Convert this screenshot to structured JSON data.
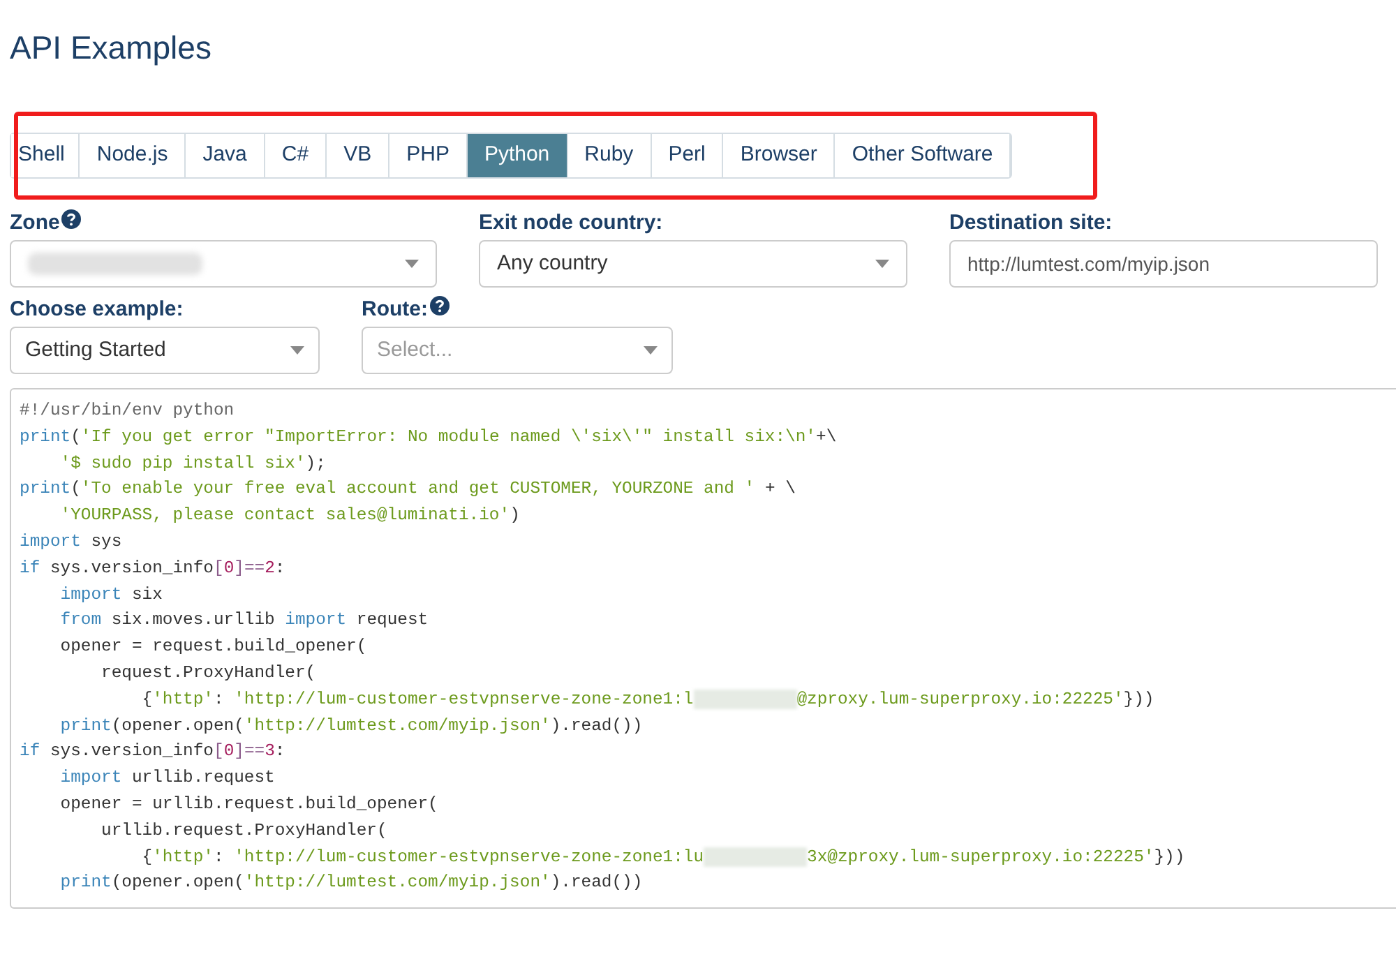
{
  "title": "API Examples",
  "tabs": [
    {
      "label": "Shell",
      "selected": false
    },
    {
      "label": "Node.js",
      "selected": false
    },
    {
      "label": "Java",
      "selected": false
    },
    {
      "label": "C#",
      "selected": false
    },
    {
      "label": "VB",
      "selected": false
    },
    {
      "label": "PHP",
      "selected": false
    },
    {
      "label": "Python",
      "selected": true
    },
    {
      "label": "Ruby",
      "selected": false
    },
    {
      "label": "Perl",
      "selected": false
    },
    {
      "label": "Browser",
      "selected": false
    },
    {
      "label": "Other Software",
      "selected": false
    }
  ],
  "zone": {
    "label": "Zone",
    "help": true,
    "redacted": true
  },
  "exit_node_country": {
    "label": "Exit node country:",
    "value": "Any country"
  },
  "destination_site": {
    "label": "Destination site:",
    "value": "http://lumtest.com/myip.json"
  },
  "choose_example": {
    "label": "Choose example:",
    "value": "Getting Started"
  },
  "route": {
    "label": "Route:",
    "help": true,
    "placeholder": "Select..."
  },
  "code": [
    [
      {
        "kind": "comment",
        "text": "#!/usr/bin/env python"
      }
    ],
    [
      {
        "kind": "kw",
        "text": "print"
      },
      {
        "kind": "plain",
        "text": "("
      },
      {
        "kind": "str",
        "text": "'If you get error \"ImportError: No module named \\'six\\'\" install six:\\n'"
      },
      {
        "kind": "plain",
        "text": "+\\"
      }
    ],
    [
      {
        "kind": "str",
        "text": "    '$ sudo pip install six'"
      },
      {
        "kind": "plain",
        "text": ");"
      }
    ],
    [
      {
        "kind": "kw",
        "text": "print"
      },
      {
        "kind": "plain",
        "text": "("
      },
      {
        "kind": "str",
        "text": "'To enable your free eval account and get CUSTOMER, YOURZONE and '"
      },
      {
        "kind": "plain",
        "text": " + \\"
      }
    ],
    [
      {
        "kind": "str",
        "text": "    'YOURPASS, please contact sales@luminati.io'"
      },
      {
        "kind": "plain",
        "text": ")"
      }
    ],
    [
      {
        "kind": "kw",
        "text": "import"
      },
      {
        "kind": "plain",
        "text": " sys"
      }
    ],
    [
      {
        "kind": "kw",
        "text": "if"
      },
      {
        "kind": "plain",
        "text": " sys.version_info"
      },
      {
        "kind": "op",
        "text": "["
      },
      {
        "kind": "num",
        "text": "0"
      },
      {
        "kind": "op",
        "text": "]=="
      },
      {
        "kind": "num",
        "text": "2"
      },
      {
        "kind": "plain",
        "text": ":"
      }
    ],
    [
      {
        "kind": "kw",
        "text": "    import"
      },
      {
        "kind": "plain",
        "text": " six"
      }
    ],
    [
      {
        "kind": "kw",
        "text": "    from"
      },
      {
        "kind": "plain",
        "text": " six.moves.urllib "
      },
      {
        "kind": "kw",
        "text": "import"
      },
      {
        "kind": "plain",
        "text": " request"
      }
    ],
    [
      {
        "kind": "plain",
        "text": "    opener = request.build_opener("
      }
    ],
    [
      {
        "kind": "plain",
        "text": "        request.ProxyHandler("
      }
    ],
    [
      {
        "kind": "plain",
        "text": "            {"
      },
      {
        "kind": "str",
        "text": "'http'"
      },
      {
        "kind": "plain",
        "text": ": "
      },
      {
        "kind": "str",
        "text": "'http://lum-customer-estvpnserve-zone-zone1:l"
      },
      {
        "kind": "redacted"
      },
      {
        "kind": "str",
        "text": "@zproxy.lum-superproxy.io:22225'"
      },
      {
        "kind": "plain",
        "text": "}))"
      }
    ],
    [
      {
        "kind": "kw",
        "text": "    print"
      },
      {
        "kind": "plain",
        "text": "(opener.open("
      },
      {
        "kind": "str",
        "text": "'http://lumtest.com/myip.json'"
      },
      {
        "kind": "plain",
        "text": ").read())"
      }
    ],
    [
      {
        "kind": "kw",
        "text": "if"
      },
      {
        "kind": "plain",
        "text": " sys.version_info"
      },
      {
        "kind": "op",
        "text": "["
      },
      {
        "kind": "num",
        "text": "0"
      },
      {
        "kind": "op",
        "text": "]=="
      },
      {
        "kind": "num",
        "text": "3"
      },
      {
        "kind": "plain",
        "text": ":"
      }
    ],
    [
      {
        "kind": "kw",
        "text": "    import"
      },
      {
        "kind": "plain",
        "text": " urllib.request"
      }
    ],
    [
      {
        "kind": "plain",
        "text": "    opener = urllib.request.build_opener("
      }
    ],
    [
      {
        "kind": "plain",
        "text": "        urllib.request.ProxyHandler("
      }
    ],
    [
      {
        "kind": "plain",
        "text": "            {"
      },
      {
        "kind": "str",
        "text": "'http'"
      },
      {
        "kind": "plain",
        "text": ": "
      },
      {
        "kind": "str",
        "text": "'http://lum-customer-estvpnserve-zone-zone1:lu"
      },
      {
        "kind": "redacted"
      },
      {
        "kind": "str",
        "text": "3x@zproxy.lum-superproxy.io:22225'"
      },
      {
        "kind": "plain",
        "text": "}))"
      }
    ],
    [
      {
        "kind": "kw",
        "text": "    print"
      },
      {
        "kind": "plain",
        "text": "(opener.open("
      },
      {
        "kind": "str",
        "text": "'http://lumtest.com/myip.json'"
      },
      {
        "kind": "plain",
        "text": ").read())"
      }
    ]
  ]
}
